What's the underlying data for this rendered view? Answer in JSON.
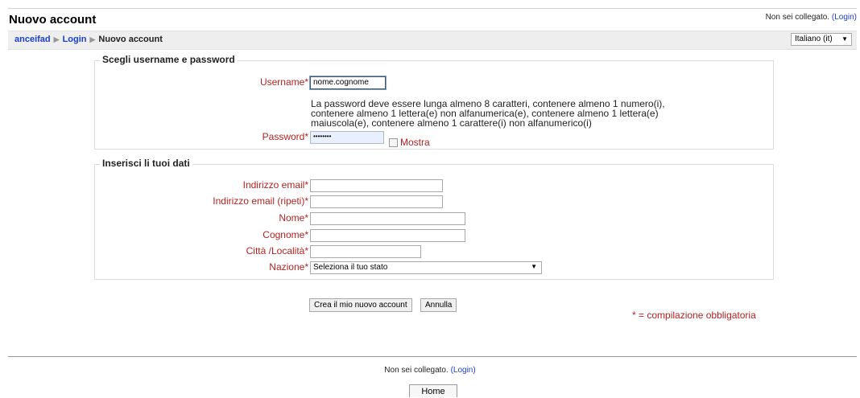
{
  "header": {
    "title": "Nuovo account",
    "login_status": "Non sei collegato.",
    "login_link": "(Login)"
  },
  "breadcrumb": {
    "site": "anceifad",
    "login": "Login",
    "current": "Nuovo account"
  },
  "language": {
    "selected": "Italiano (it)"
  },
  "section_credentials": {
    "legend": "Scegli username e password",
    "username_label": "Username*",
    "username_value": "nome.cognome",
    "password_rules": "La password deve essere lunga almeno 8 caratteri, contenere almeno 1 numero(i), contenere almeno 1 lettera(e) non alfanumerica(e), contenere almeno 1 lettera(e) maiuscola(e), contenere almeno 1 carattere(i) non alfanumerico(i)",
    "password_label": "Password*",
    "password_value": "••••••••",
    "show_label": "Mostra"
  },
  "section_details": {
    "legend": "Inserisci li tuoi dati",
    "email_label": "Indirizzo email*",
    "email_repeat_label": "Indirizzo email (ripeti)*",
    "firstname_label": "Nome*",
    "lastname_label": "Cognome*",
    "city_label": "Città /Località*",
    "country_label": "Nazione*",
    "country_selected": "Seleziona il tuo stato"
  },
  "actions": {
    "submit": "Crea il mio nuovo account",
    "cancel": "Annulla",
    "required_note": "* = compilazione obbligatoria"
  },
  "footer": {
    "login_status": "Non sei collegato.",
    "login_link": "(Login)",
    "home": "Home"
  }
}
